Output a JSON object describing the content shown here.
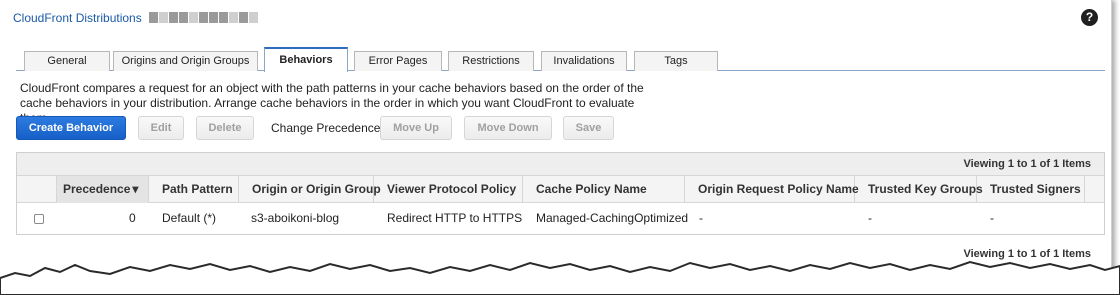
{
  "breadcrumb": {
    "link": "CloudFront Distributions"
  },
  "help": {
    "label": "?"
  },
  "tabs": [
    {
      "label": "General"
    },
    {
      "label": "Origins and Origin Groups"
    },
    {
      "label": "Behaviors"
    },
    {
      "label": "Error Pages"
    },
    {
      "label": "Restrictions"
    },
    {
      "label": "Invalidations"
    },
    {
      "label": "Tags"
    }
  ],
  "description": "CloudFront compares a request for an object with the path patterns in your cache behaviors based on the order of the cache behaviors in your distribution. Arrange cache behaviors in the order in which you want CloudFront to evaluate them.",
  "toolbar": {
    "create": "Create Behavior",
    "edit": "Edit",
    "delete": "Delete",
    "change_precedence": "Change Precedence:",
    "move_up": "Move Up",
    "move_down": "Move Down",
    "save": "Save"
  },
  "table": {
    "count": "Viewing 1 to 1 of 1 Items",
    "sort_indicator": "▾",
    "columns": [
      "Precedence",
      "Path Pattern",
      "Origin or Origin Group",
      "Viewer Protocol Policy",
      "Cache Policy Name",
      "Origin Request Policy Name",
      "Trusted Key Groups",
      "Trusted Signers"
    ],
    "rows": [
      [
        "0",
        "Default (*)",
        "s3-aboikoni-blog",
        "Redirect HTTP to HTTPS",
        "Managed-CachingOptimized",
        "-",
        "-",
        "-"
      ]
    ]
  },
  "colors": {
    "accent": "#1660c8",
    "link": "#1a5aa8"
  }
}
